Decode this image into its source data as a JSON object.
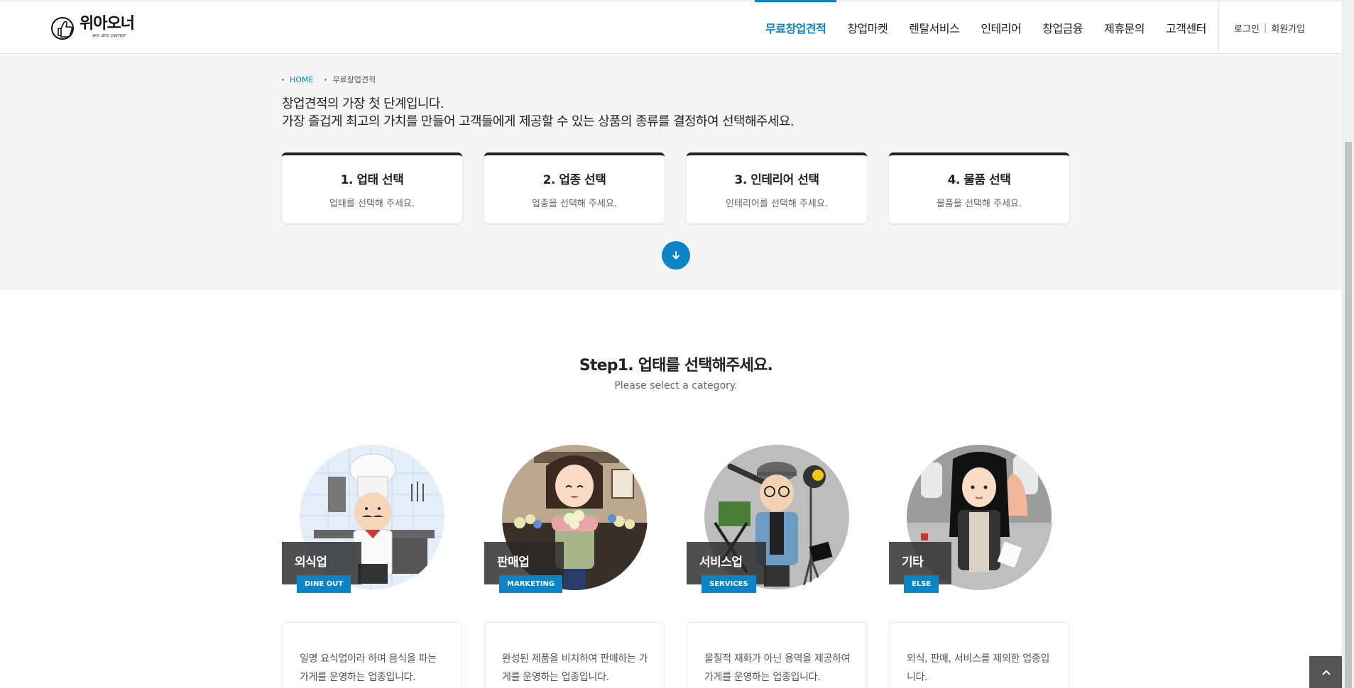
{
  "header": {
    "logo_name": "위아오너",
    "logo_sub": "we are owner",
    "nav": [
      {
        "label": "무료창업견적",
        "active": true
      },
      {
        "label": "창업마켓"
      },
      {
        "label": "렌탈서비스"
      },
      {
        "label": "인테리어"
      },
      {
        "label": "창업금융"
      },
      {
        "label": "제휴문의"
      },
      {
        "label": "고객센터"
      }
    ],
    "login": "로그인",
    "auth_divider": "|",
    "signup": "회원가입"
  },
  "breadcrumb": {
    "home": "HOME",
    "current": "무료창업견적"
  },
  "intro": {
    "line1": "창업견적의 가장 첫 단계입니다.",
    "line2": "가장 즐겁게 최고의 가치를 만들어 고객들에게 제공할 수 있는 상품의 종류를 결정하여 선택해주세요."
  },
  "steps": [
    {
      "title": "1. 업태 선택",
      "desc": "업태를 선택해 주세요."
    },
    {
      "title": "2. 업종 선택",
      "desc": "업종을 선택해 주세요."
    },
    {
      "title": "3. 인테리어 선택",
      "desc": "인테리어를 선택해 주세요."
    },
    {
      "title": "4. 물품 선택",
      "desc": "물품을 선택해 주세요."
    }
  ],
  "section": {
    "title_prefix": "Step1.",
    "title_main": "업태를 선택해주세요.",
    "subtitle": "Please select a category."
  },
  "categories": [
    {
      "label": "외식업",
      "badge": "DINE OUT",
      "desc": "일명 요식업이라 하며 음식을 파는 가게를 운영하는 업종입니다."
    },
    {
      "label": "판매업",
      "badge": "MARKETING",
      "desc": "완성된 제품을 비치하여 판매하는 가게를 운영하는 업종입니다."
    },
    {
      "label": "서비스업",
      "badge": "SERVICES",
      "desc": "물질적 재화가 아닌 용역을 제공하여 가게를 운영하는 업종입니다."
    },
    {
      "label": "기타",
      "badge": "ELSE",
      "desc": "외식, 판매, 서비스를 제외한 업종입니다."
    }
  ],
  "colors": {
    "accent": "#0a84c6",
    "dark": "#222222",
    "section_bg": "#f5f5f5"
  }
}
